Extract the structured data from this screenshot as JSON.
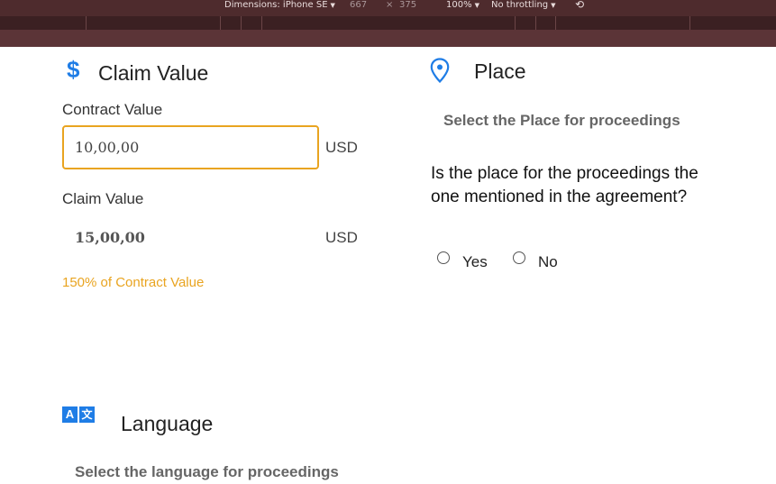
{
  "devtools": {
    "dimensions_label": "Dimensions: iPhone SE",
    "width": "667",
    "times": "×",
    "height": "375",
    "zoom": "100%",
    "throttling": "No throttling"
  },
  "claim": {
    "title": "Claim Value",
    "contract_label": "Contract Value",
    "contract_value": "10,00,00",
    "contract_currency": "USD",
    "claim_label": "Claim Value",
    "claim_value": "15,00,00",
    "claim_currency": "USD",
    "percent_note": "150% of Contract Value"
  },
  "place": {
    "title": "Place",
    "subtitle": "Select the Place for proceedings",
    "question": "Is the place for the proceedings the one mentioned in the agreement?",
    "options": [
      {
        "label": "Yes",
        "selected": false
      },
      {
        "label": "No",
        "selected": false
      }
    ]
  },
  "language": {
    "title": "Language",
    "subtitle": "Select the language for proceedings"
  },
  "icons": {
    "claim": "dollar-icon",
    "place": "location-pin-icon",
    "language": "translate-icon"
  },
  "colors": {
    "accent": "#1f7de6",
    "warning": "#e9a420",
    "devtools_bar": "#4e2b2d"
  }
}
